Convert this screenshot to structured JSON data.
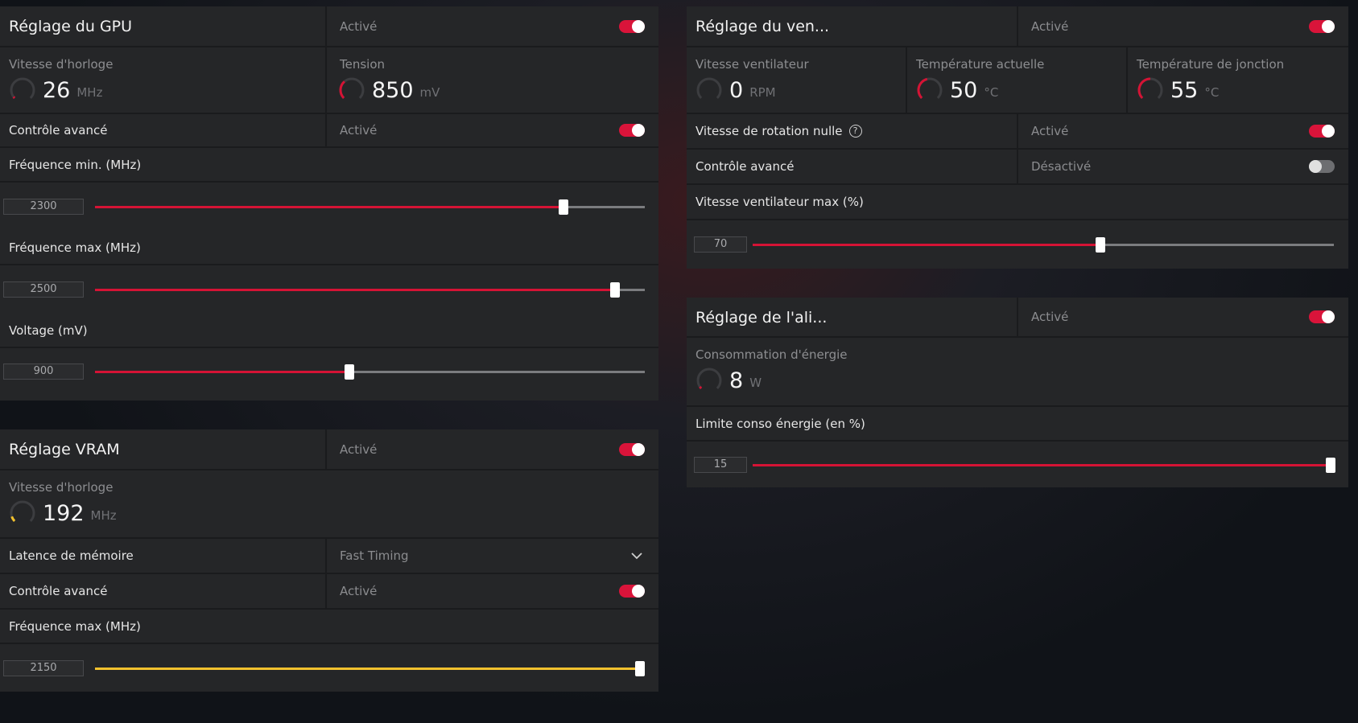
{
  "gpu": {
    "title": "Réglage du GPU",
    "status": "Activé",
    "clock_label": "Vitesse d'horloge",
    "clock_value": "26",
    "clock_unit": "MHz",
    "voltage_label": "Tension",
    "voltage_value": "850",
    "voltage_unit": "mV",
    "advanced_label": "Contrôle avancé",
    "advanced_status": "Activé",
    "min_freq_label": "Fréquence min. (MHz)",
    "min_freq_value": "2300",
    "min_freq_fraction": 0.852,
    "max_freq_label": "Fréquence max (MHz)",
    "max_freq_value": "2500",
    "max_freq_fraction": 0.946,
    "voltage_slider_label": "Voltage (mV)",
    "voltage_slider_value": "900",
    "voltage_slider_fraction": 0.463,
    "clock_gauge_fraction": 0.03,
    "voltage_gauge_fraction": 0.35
  },
  "vram": {
    "title": "Réglage VRAM",
    "status": "Activé",
    "clock_label": "Vitesse d'horloge",
    "clock_value": "192",
    "clock_unit": "MHz",
    "clock_gauge_fraction": 0.1,
    "latency_label": "Latence de mémoire",
    "latency_value": "Fast Timing",
    "advanced_label": "Contrôle avancé",
    "advanced_status": "Activé",
    "max_freq_label": "Fréquence max (MHz)",
    "max_freq_value": "2150",
    "max_freq_fraction": 1.0
  },
  "fan": {
    "title": "Réglage du ven...",
    "status": "Activé",
    "speed_label": "Vitesse ventilateur",
    "speed_value": "0",
    "speed_unit": "RPM",
    "speed_gauge_fraction": 0.0,
    "temp_label": "Température actuelle",
    "temp_value": "50",
    "temp_unit": "°C",
    "temp_gauge_fraction": 0.45,
    "junction_label": "Température de jonction",
    "junction_value": "55",
    "junction_unit": "°C",
    "junction_gauge_fraction": 0.5,
    "zero_rpm_label": "Vitesse de rotation nulle",
    "zero_rpm_help": "?",
    "zero_rpm_status": "Activé",
    "advanced_label": "Contrôle avancé",
    "advanced_status": "Désactivé",
    "max_speed_label": "Vitesse ventilateur max (%)",
    "max_speed_value": "70",
    "max_speed_fraction": 0.599
  },
  "power": {
    "title": "Réglage de l'ali...",
    "status": "Activé",
    "consumption_label": "Consommation d'énergie",
    "consumption_value": "8",
    "consumption_unit": "W",
    "consumption_gauge_fraction": 0.04,
    "limit_label": "Limite conso énergie (en %)",
    "limit_value": "15",
    "limit_fraction": 1.0
  },
  "colors": {
    "accent_red": "#d51335",
    "accent_yellow": "#f2c12e",
    "panel_bg": "#252628"
  }
}
